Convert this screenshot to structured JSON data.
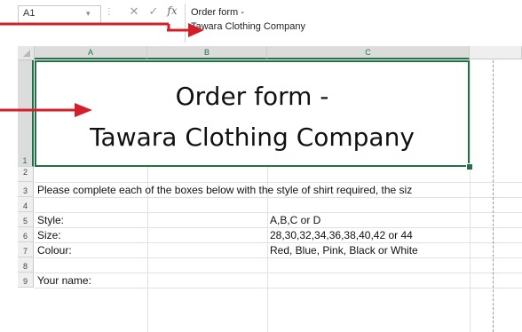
{
  "formula_bar": {
    "name_box": "A1",
    "formula_line1": "Order form -",
    "formula_line2": "Tawara Clothing Company",
    "cancel_glyph": "✕",
    "enter_glyph": "✓",
    "fx_label": "fx",
    "separator_glyph": "⋮"
  },
  "columns": [
    "A",
    "B",
    "C"
  ],
  "rows": [
    "1",
    "2",
    "3",
    "4",
    "5",
    "6",
    "7",
    "8",
    "9"
  ],
  "title": {
    "line1": "Order form -",
    "line2": "Tawara Clothing Company"
  },
  "instructions": "Please complete each of the boxes below with the style of shirt required, the siz",
  "fields": [
    {
      "label": "Style:",
      "value": "A,B,C or D"
    },
    {
      "label": "Size:",
      "value": "28,30,32,34,36,38,40,42 or 44"
    },
    {
      "label": "Colour:",
      "value": "Red, Blue, Pink, Black or White"
    }
  ],
  "your_name_label": "Your name:",
  "colors": {
    "selection": "#217346",
    "arrow": "#d21f2a"
  },
  "icons": [
    "dropdown-arrow-icon",
    "cancel-icon",
    "enter-icon",
    "insert-function-icon",
    "select-all-icon",
    "callout-arrow-icon"
  ]
}
